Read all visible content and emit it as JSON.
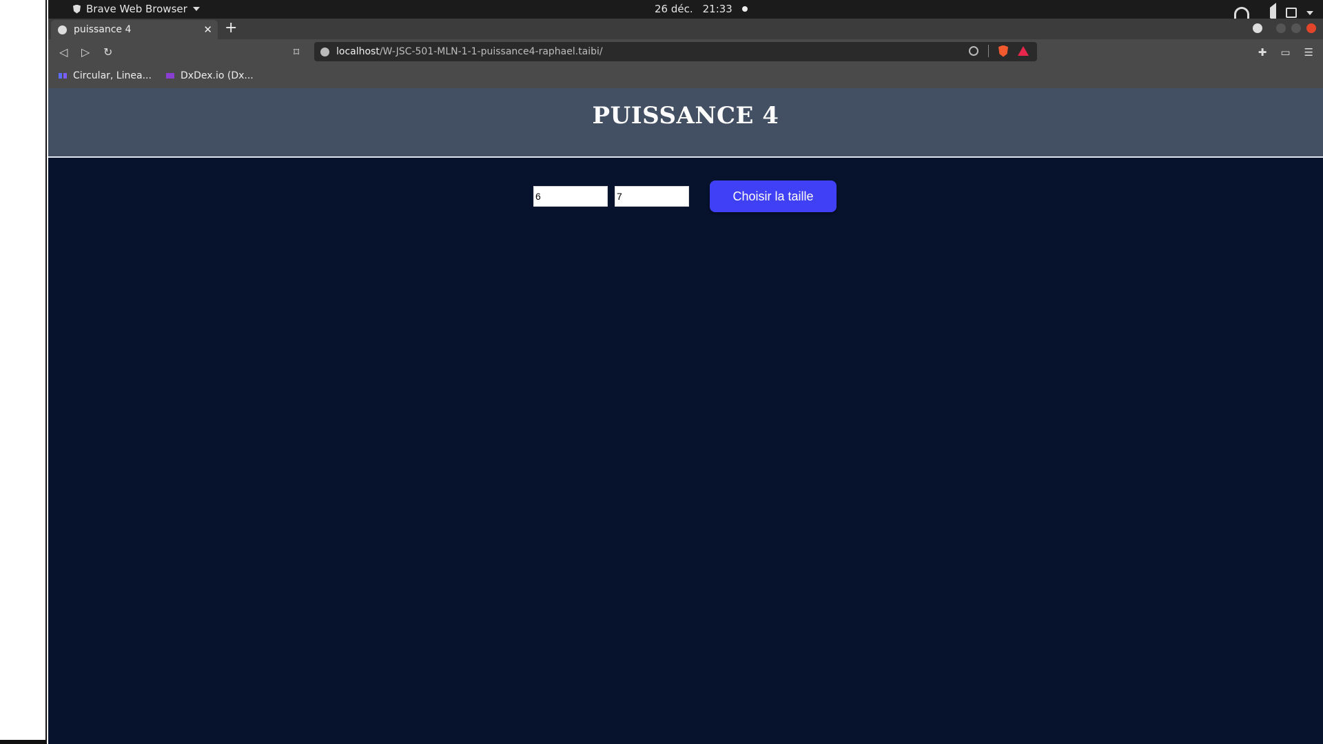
{
  "system": {
    "app_name": "Brave Web Browser",
    "date": "26 déc.",
    "time": "21:33"
  },
  "browser": {
    "tab_title": "puissance 4",
    "tab_close": "✕",
    "new_tab": "+",
    "url_host": "localhost",
    "url_path": "/W-JSC-501-MLN-1-1-puissance4-raphael.taibi/",
    "bookmarks": [
      {
        "label": "Circular, Linea..."
      },
      {
        "label": "DxDex.io (Dx..."
      }
    ]
  },
  "page": {
    "title": "PUISSANCE 4",
    "rows_value": "6",
    "cols_value": "7",
    "choose_button": "Choisir la taille"
  },
  "colors": {
    "header_bg": "#434f62",
    "page_bg": "#07122c",
    "button_bg": "#4040f6"
  }
}
